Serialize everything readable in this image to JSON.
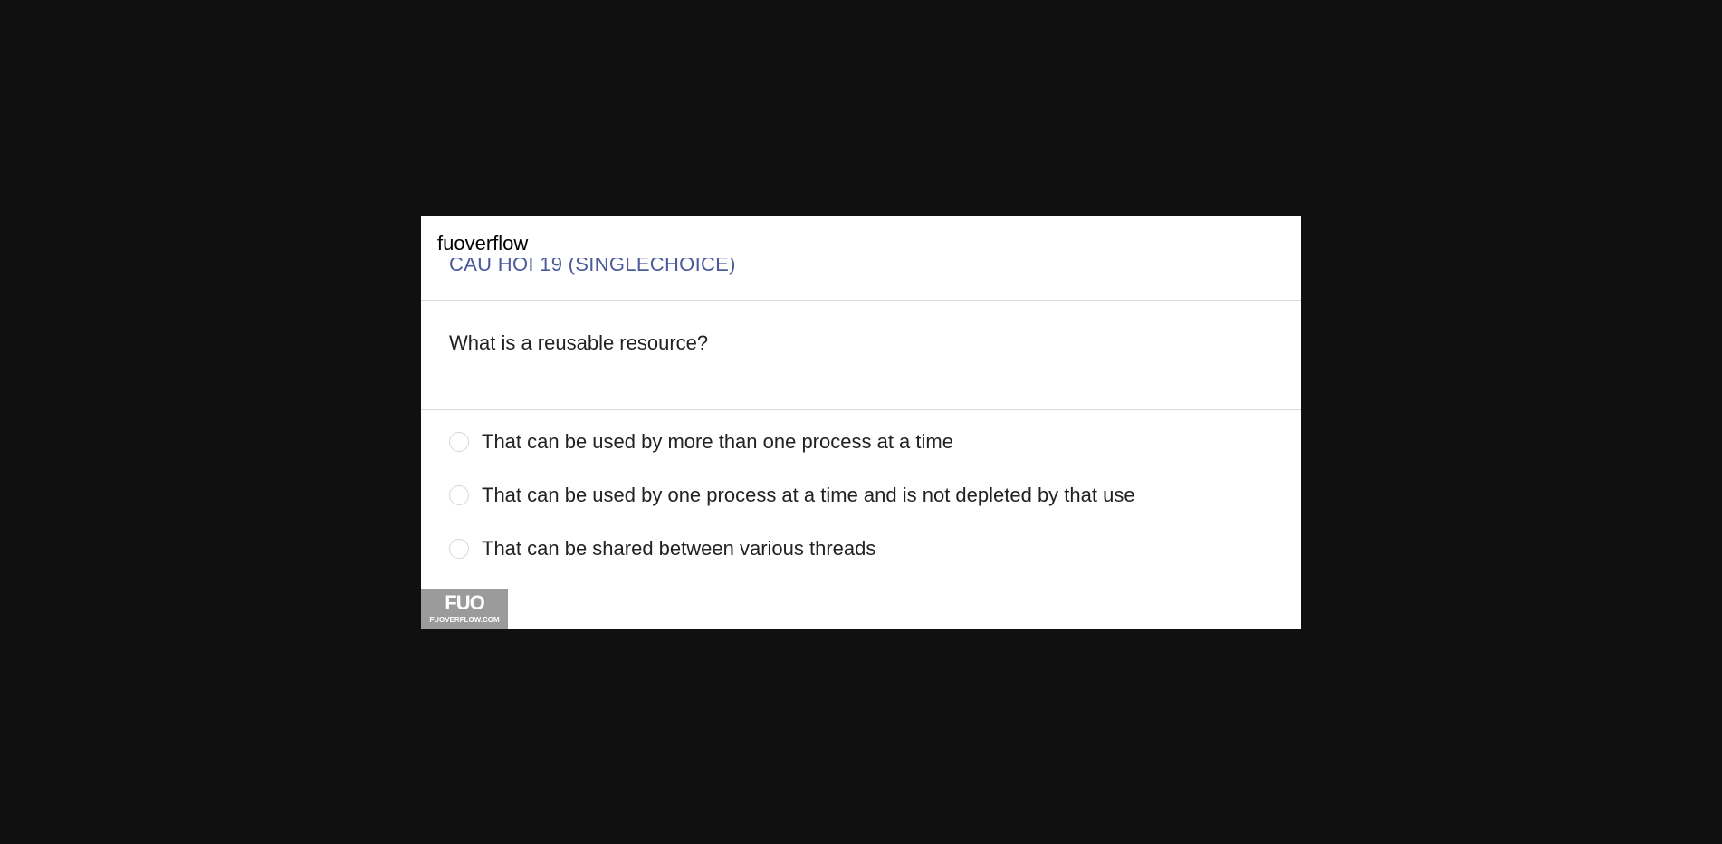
{
  "watermark": {
    "text": "fuoverflow"
  },
  "question": {
    "title": "CÂU HỎI 19 (SINGLECHOICE)",
    "text": "What is a reusable resource?"
  },
  "options": [
    {
      "label": "That can be used by more than one process at a time",
      "selected": false
    },
    {
      "label": "That can be used by one process at a time and is not depleted by that use",
      "selected": false
    },
    {
      "label": "That can be shared between various threads",
      "selected": false
    }
  ],
  "logo": {
    "mark": "FUO",
    "site": "FUOVERFLOW.COM"
  },
  "colors": {
    "background": "#101010",
    "card": "#ffffff",
    "title": "#4a5a9a",
    "logo_bg": "#9b9b9b"
  }
}
